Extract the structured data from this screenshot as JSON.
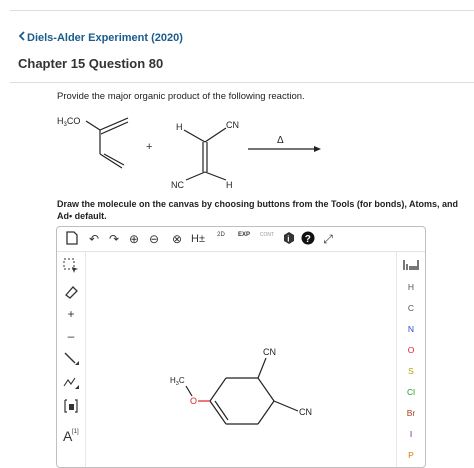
{
  "header": {
    "back_label": "Diels-Alder Experiment (2020)",
    "chapter_title": "Chapter 15 Question 80"
  },
  "question": {
    "prompt": "Provide the major organic product of the following reaction.",
    "instructions": "Draw the molecule on the canvas by choosing buttons from the Tools (for bonds), Atoms, and Ad• default."
  },
  "reaction": {
    "diene_substituent": "H3CO",
    "plus": "+",
    "dienophile_top_h": "H",
    "dienophile_top_cn": "CN",
    "dienophile_bottom_nc": "NC",
    "dienophile_bottom_h": "H",
    "arrow_condition": "Δ"
  },
  "toolbar": {
    "new_label": "🗋",
    "undo_label": "↶",
    "redo_label": "↷",
    "zoom_in_label": "⊕",
    "zoom_out_label": "⊖",
    "clear_label": "⊗",
    "h_toggle_label": "H±",
    "two_d_label": "2D",
    "exp_label": "EXP",
    "cont_label": "CONT",
    "info_label": "i",
    "help_label": "?",
    "fullscreen_label": "⤢"
  },
  "left_tools": [
    "⬚",
    "⬯",
    "+",
    "–",
    "/",
    "✥",
    "[□]",
    "A"
  ],
  "atoms": {
    "periodic_label": "▓",
    "items": [
      {
        "symbol": "H",
        "color": "#555555"
      },
      {
        "symbol": "C",
        "color": "#555555"
      },
      {
        "symbol": "N",
        "color": "#2c4bd6"
      },
      {
        "symbol": "O",
        "color": "#e02020"
      },
      {
        "symbol": "S",
        "color": "#b8a000"
      },
      {
        "symbol": "Cl",
        "color": "#2a9a2a"
      },
      {
        "symbol": "Br",
        "color": "#a04020"
      },
      {
        "symbol": "I",
        "color": "#7a1a9a"
      },
      {
        "symbol": "P",
        "color": "#d07a00"
      }
    ]
  },
  "canvas": {
    "product_methyl": "H3C",
    "product_cn_top": "CN",
    "product_cn_right": "CN"
  }
}
